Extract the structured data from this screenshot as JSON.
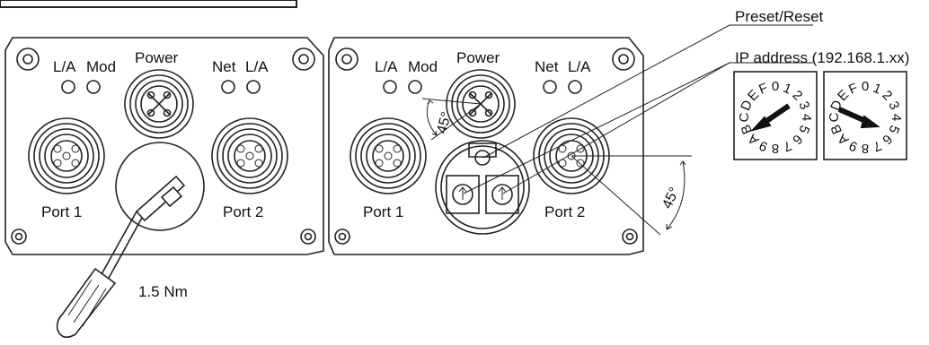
{
  "colors": {
    "line": "#222222",
    "background": "#ffffff"
  },
  "left_panel": {
    "led_labels": [
      "L/A",
      "Mod",
      "Net",
      "L/A"
    ],
    "power_label": "Power",
    "port1_label": "Port 1",
    "port2_label": "Port 2",
    "torque_label": "1.5 Nm"
  },
  "right_panel": {
    "led_labels": [
      "L/A",
      "Mod",
      "Net",
      "L/A"
    ],
    "power_label": "Power",
    "port1_label": "Port 1",
    "port2_label": "Port 2",
    "angle_power": "45°",
    "angle_port2": "45°",
    "callout_preset": "Preset/Reset",
    "callout_ip": "IP address (192.168.1.xx)"
  },
  "rotary_switches": [
    {
      "digits": [
        "0",
        "1",
        "2",
        "3",
        "4",
        "5",
        "6",
        "7",
        "8",
        "9",
        "A",
        "B",
        "C",
        "D",
        "E",
        "F"
      ],
      "pointer_icon": "arrow-pointer-icon",
      "setting": "A"
    },
    {
      "digits": [
        "0",
        "1",
        "2",
        "3",
        "4",
        "5",
        "6",
        "7",
        "8",
        "9",
        "A",
        "B",
        "C",
        "D",
        "E",
        "F"
      ],
      "pointer_icon": "arrow-pointer-icon",
      "setting": "4"
    }
  ]
}
